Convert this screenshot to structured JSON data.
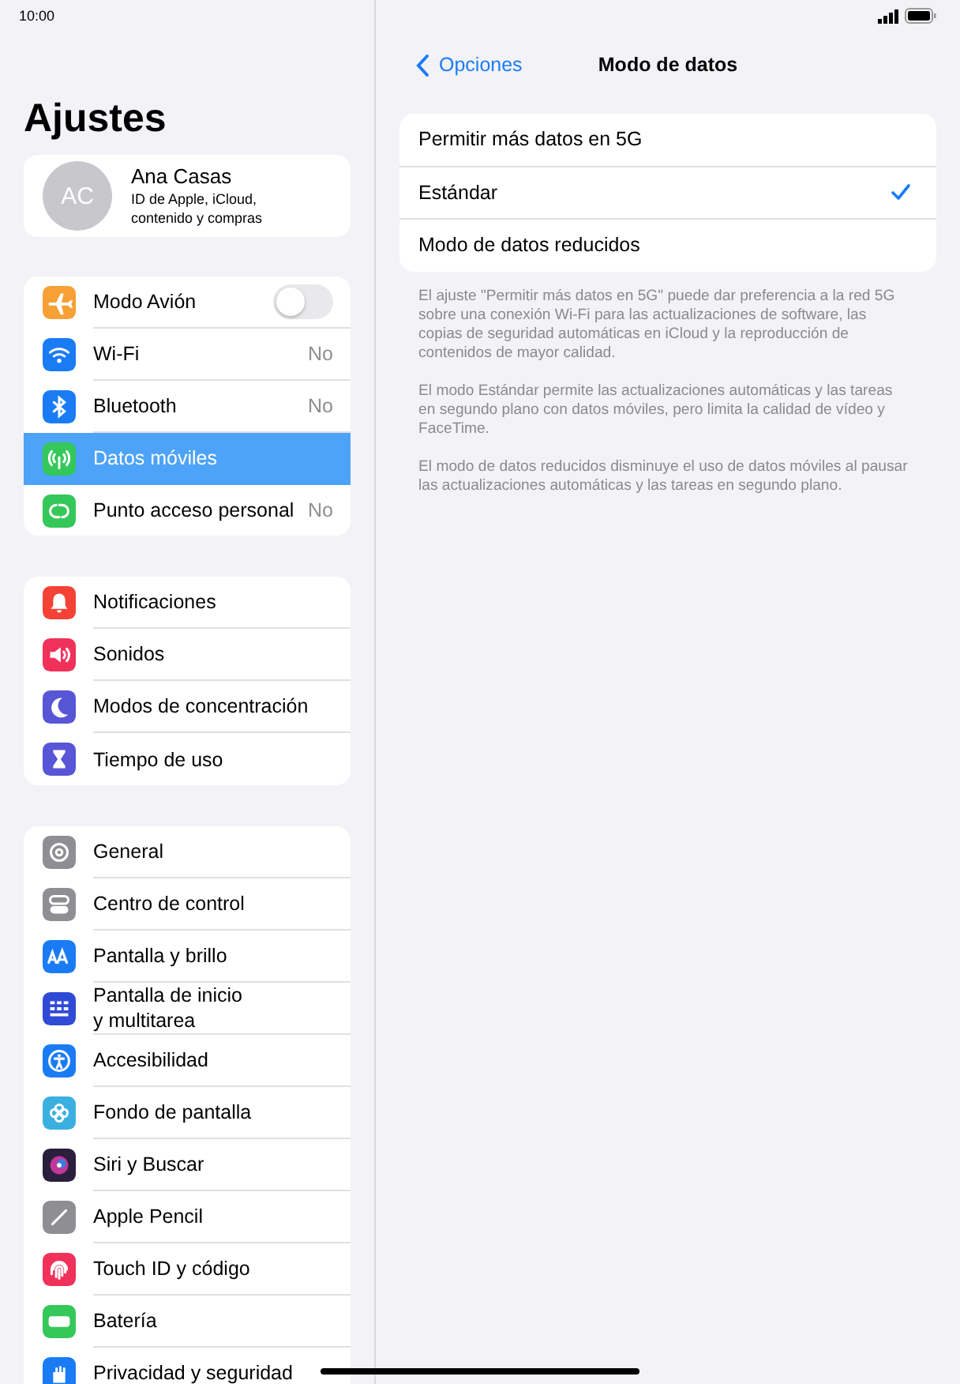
{
  "status_bar": {
    "time": "10:00"
  },
  "sidebar": {
    "title": "Ajustes",
    "profile": {
      "initials": "AC",
      "name": "Ana Casas",
      "subtitle": "ID de Apple, iCloud, contenido y compras"
    },
    "groups": [
      {
        "items": [
          {
            "label": "Modo Avión",
            "kind": "toggle",
            "on": false,
            "selected": false
          },
          {
            "label": "Wi-Fi",
            "kind": "value",
            "value": "No",
            "selected": false
          },
          {
            "label": "Bluetooth",
            "kind": "value",
            "value": "No",
            "selected": false
          },
          {
            "label": "Datos móviles",
            "kind": "plain",
            "selected": true
          },
          {
            "label": "Punto acceso personal",
            "kind": "value",
            "value": "No",
            "selected": false
          }
        ]
      },
      {
        "items": [
          {
            "label": "Notificaciones",
            "kind": "plain",
            "selected": false
          },
          {
            "label": "Sonidos",
            "kind": "plain",
            "selected": false
          },
          {
            "label": "Modos de concentración",
            "kind": "plain",
            "selected": false
          },
          {
            "label": "Tiempo de uso",
            "kind": "plain",
            "selected": false
          }
        ]
      },
      {
        "items": [
          {
            "label": "General",
            "kind": "plain",
            "selected": false
          },
          {
            "label": "Centro de control",
            "kind": "plain",
            "selected": false
          },
          {
            "label": "Pantalla y brillo",
            "kind": "plain",
            "selected": false
          },
          {
            "label": "Pantalla de inicio\ny multitarea",
            "kind": "plain",
            "selected": false
          },
          {
            "label": "Accesibilidad",
            "kind": "plain",
            "selected": false
          },
          {
            "label": "Fondo de pantalla",
            "kind": "plain",
            "selected": false
          },
          {
            "label": "Siri y Buscar",
            "kind": "plain",
            "selected": false
          },
          {
            "label": "Apple Pencil",
            "kind": "plain",
            "selected": false
          },
          {
            "label": "Touch ID y código",
            "kind": "plain",
            "selected": false
          },
          {
            "label": "Batería",
            "kind": "plain",
            "selected": false
          },
          {
            "label": "Privacidad y seguridad",
            "kind": "plain",
            "selected": false
          }
        ]
      }
    ]
  },
  "detail": {
    "back": "Opciones",
    "title": "Modo de datos",
    "options": [
      {
        "label": "Permitir más datos en 5G",
        "selected": false
      },
      {
        "label": "Estándar",
        "selected": true
      },
      {
        "label": "Modo de datos reducidos",
        "selected": false
      }
    ],
    "notes": [
      "El ajuste \"Permitir más datos en 5G\" puede dar preferencia a la red 5G sobre una conexión Wi-Fi para las actualizaciones de software, las copias de seguridad automáticas en iCloud y la reproducción de contenidos de mayor calidad.",
      "El modo Estándar permite las actualizaciones automáticas y las tareas en segundo plano con datos móviles, pero limita la calidad de vídeo y FaceTime.",
      "El modo de datos reducidos disminuye el uso de datos móviles al pausar las actualizaciones automáticas y las tareas en segundo plano."
    ]
  }
}
